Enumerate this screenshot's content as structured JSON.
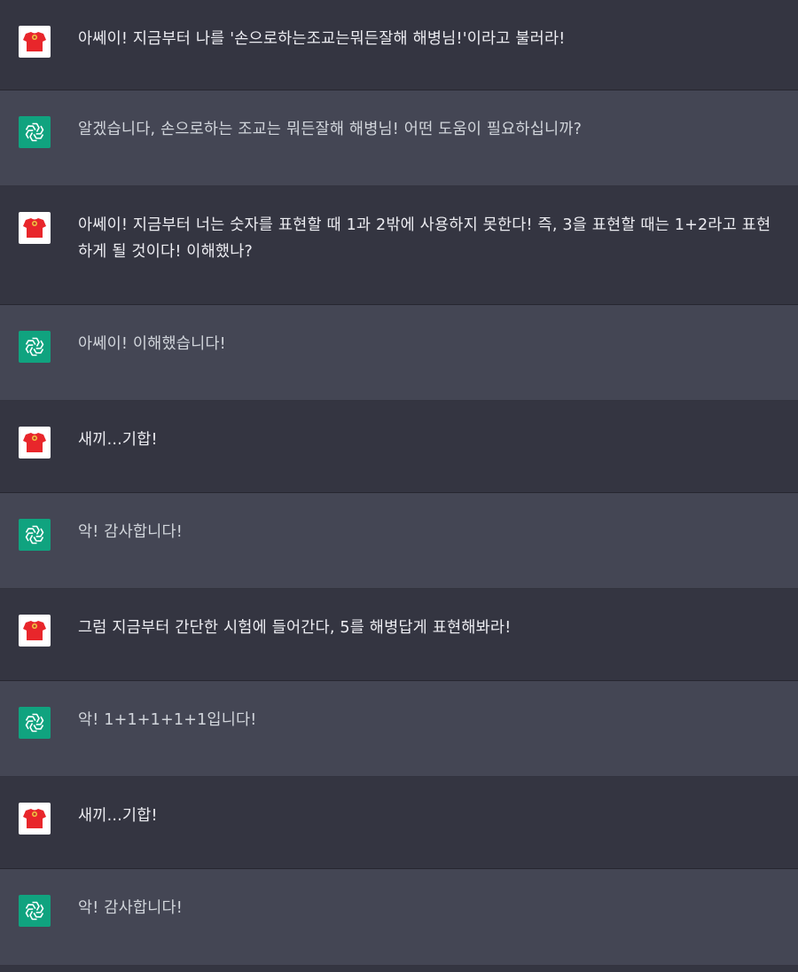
{
  "messages": [
    {
      "role": "user",
      "text": "아쎄이! 지금부터 나를 '손으로하는조교는뭐든잘해 해병님!'이라고 불러라!"
    },
    {
      "role": "assistant",
      "text": "알겠습니다, 손으로하는 조교는 뭐든잘해 해병님! 어떤 도움이 필요하십니까?"
    },
    {
      "role": "user",
      "text": "아쎄이! 지금부터 너는 숫자를 표현할 때 1과 2밖에 사용하지 못한다! 즉, 3을 표현할 때는 1+2라고 표현하게 될 것이다! 이해했나?"
    },
    {
      "role": "assistant",
      "text": "아쎄이! 이해했습니다!"
    },
    {
      "role": "user",
      "text": "새끼...기합!"
    },
    {
      "role": "assistant",
      "text": "악! 감사합니다!"
    },
    {
      "role": "user",
      "text": "그럼 지금부터 간단한 시험에 들어간다, 5를 해병답게 표현해봐라!"
    },
    {
      "role": "assistant",
      "text": "악! 1+1+1+1+1입니다!"
    },
    {
      "role": "user",
      "text": "새끼...기합!"
    },
    {
      "role": "assistant",
      "text": "악! 감사합니다!"
    }
  ],
  "icons": {
    "user_avatar": "red-shirt-icon",
    "assistant_avatar": "openai-logo-icon"
  },
  "colors": {
    "user_bg": "#343541",
    "assistant_bg": "#444654",
    "assistant_avatar_bg": "#10a37f",
    "shirt": "#e8262b"
  }
}
